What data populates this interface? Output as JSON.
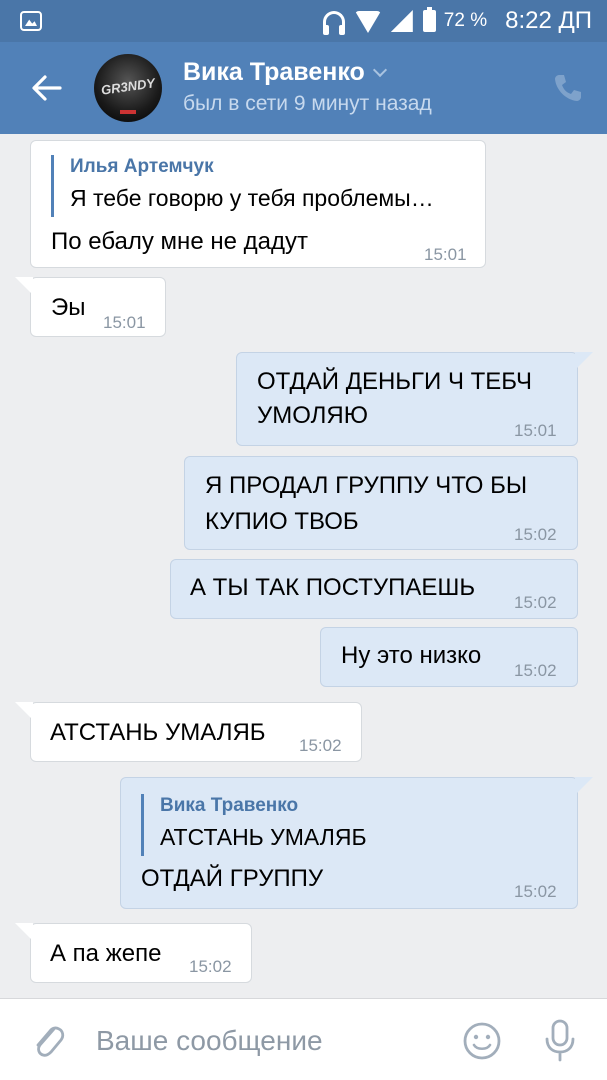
{
  "status_bar": {
    "battery": "72 %",
    "time": "8:22 ДП",
    "icons": [
      "vk-app-icon",
      "headset-icon",
      "wifi-icon",
      "signal-icon",
      "battery-icon"
    ]
  },
  "header": {
    "contact_name": "Вика Травенко",
    "status": "был в сети 9 минут назад",
    "avatar_text": "GR3NDY",
    "icons": [
      "back-arrow-icon",
      "chevron-down-icon",
      "phone-icon"
    ]
  },
  "messages": [
    {
      "dir": "in",
      "reply_author": "Илья Артемчук",
      "reply_text": "Я тебе говорю у тебя проблемы…",
      "text": "По ебалу мне не дадут",
      "time": "15:01"
    },
    {
      "dir": "in",
      "text": "Эы",
      "time": "15:01"
    },
    {
      "dir": "out",
      "line1": "ОТДАЙ ДЕНЬГИ Ч ТЕБЧ",
      "line2": "УМОЛЯЮ",
      "time": "15:01"
    },
    {
      "dir": "out",
      "line1": "Я ПРОДАЛ ГРУППУ ЧТО БЫ",
      "line2": "КУПИО ТВОБ",
      "time": "15:02"
    },
    {
      "dir": "out",
      "text": "А ТЫ ТАК ПОСТУПАЕШЬ",
      "time": "15:02"
    },
    {
      "dir": "out",
      "text": "Ну это низко",
      "time": "15:02"
    },
    {
      "dir": "in",
      "text": "АТСТАНЬ УМАЛЯБ",
      "time": "15:02"
    },
    {
      "dir": "out",
      "reply_author": "Вика Травенко",
      "reply_text": "АТСТАНЬ УМАЛЯБ",
      "text": "ОТДАЙ ГРУППУ",
      "time": "15:02"
    },
    {
      "dir": "in",
      "text": "А па жепе",
      "time": "15:02"
    }
  ],
  "composer": {
    "placeholder": "Ваше сообщение",
    "icons": [
      "paperclip-icon",
      "emoji-icon",
      "microphone-icon"
    ]
  },
  "colors": {
    "header_bg": "#5181b8",
    "status_bar_bg": "#4a76a8",
    "chat_bg": "#edeef0",
    "incoming_bubble": "#ffffff",
    "outgoing_bubble": "#dce8f6",
    "reply_accent": "#4a76a8"
  }
}
